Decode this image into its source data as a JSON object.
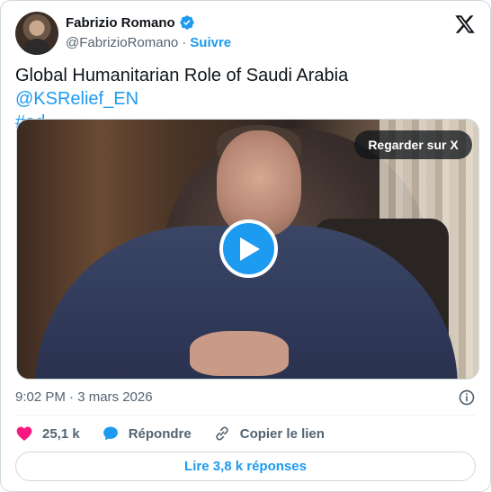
{
  "author": {
    "name": "Fabrizio Romano",
    "handle": "@FabrizioRomano",
    "separator": "·",
    "follow_label": "Suivre"
  },
  "tweet": {
    "text": "Global Humanitarian Role of Saudi Arabia ",
    "mention": "@KSRelief_EN",
    "hashtag": "#ad"
  },
  "media": {
    "watch_label": "Regarder sur X"
  },
  "meta": {
    "timestamp": "9:02 PM · 3 mars 2026"
  },
  "actions": {
    "likes": "25,1 k",
    "reply_label": "Répondre",
    "copy_label": "Copier le lien"
  },
  "replies_button": "Lire 3,8 k réponses",
  "colors": {
    "accent": "#1d9bf0",
    "like": "#f91880",
    "text": "#0f1419",
    "muted": "#536471"
  }
}
